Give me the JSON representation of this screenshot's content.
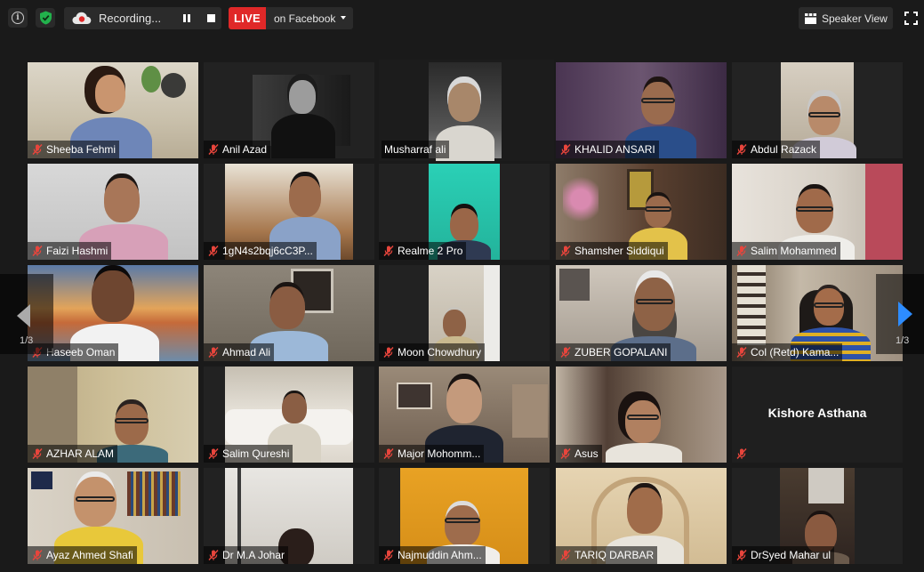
{
  "topbar": {
    "recording_label": "Recording...",
    "live_label": "LIVE",
    "live_target": "on Facebook",
    "speaker_view_label": "Speaker View"
  },
  "paging": {
    "left_count": "1/3",
    "right_count": "1/3"
  },
  "colors": {
    "live_red": "#e02828",
    "active_speaker_border": "#dfe88a",
    "next_arrow": "#2d8cff",
    "muted_mic": "#e8453c"
  },
  "participants": [
    {
      "name": "Sheeba Fehmi",
      "muted": true
    },
    {
      "name": "Anil Azad",
      "muted": true
    },
    {
      "name": "Musharraf ali",
      "muted": false,
      "active": true
    },
    {
      "name": "KHALID ANSARI",
      "muted": true
    },
    {
      "name": "Abdul Razack",
      "muted": true
    },
    {
      "name": "Faizi Hashmi",
      "muted": true
    },
    {
      "name": "1gN4s2bqj6cC3P...",
      "muted": true
    },
    {
      "name": "Realme 2 Pro",
      "muted": true
    },
    {
      "name": "Shamsher Siddiqui",
      "muted": true
    },
    {
      "name": "Salim Mohammed",
      "muted": true
    },
    {
      "name": "Haseeb Oman",
      "muted": true
    },
    {
      "name": "Ahmad Ali",
      "muted": true
    },
    {
      "name": "Moon Chowdhury",
      "muted": true
    },
    {
      "name": "ZUBER GOPALANI",
      "muted": true
    },
    {
      "name": "Col (Retd) Kama...",
      "muted": true
    },
    {
      "name": "AZHAR ALAM",
      "muted": true
    },
    {
      "name": "Salim Qureshi",
      "muted": true
    },
    {
      "name": "Major Mohomm...",
      "muted": true
    },
    {
      "name": "Asus",
      "muted": true
    },
    {
      "name": "Kishore Asthana",
      "muted": true,
      "video_off": true
    },
    {
      "name": "Ayaz Ahmed Shafi",
      "muted": true
    },
    {
      "name": "Dr M.A Johar",
      "muted": true
    },
    {
      "name": "Najmuddin Ahm...",
      "muted": true
    },
    {
      "name": "TARIQ DARBAR",
      "muted": true
    },
    {
      "name": "DrSyed Mahar ul",
      "muted": true
    }
  ]
}
